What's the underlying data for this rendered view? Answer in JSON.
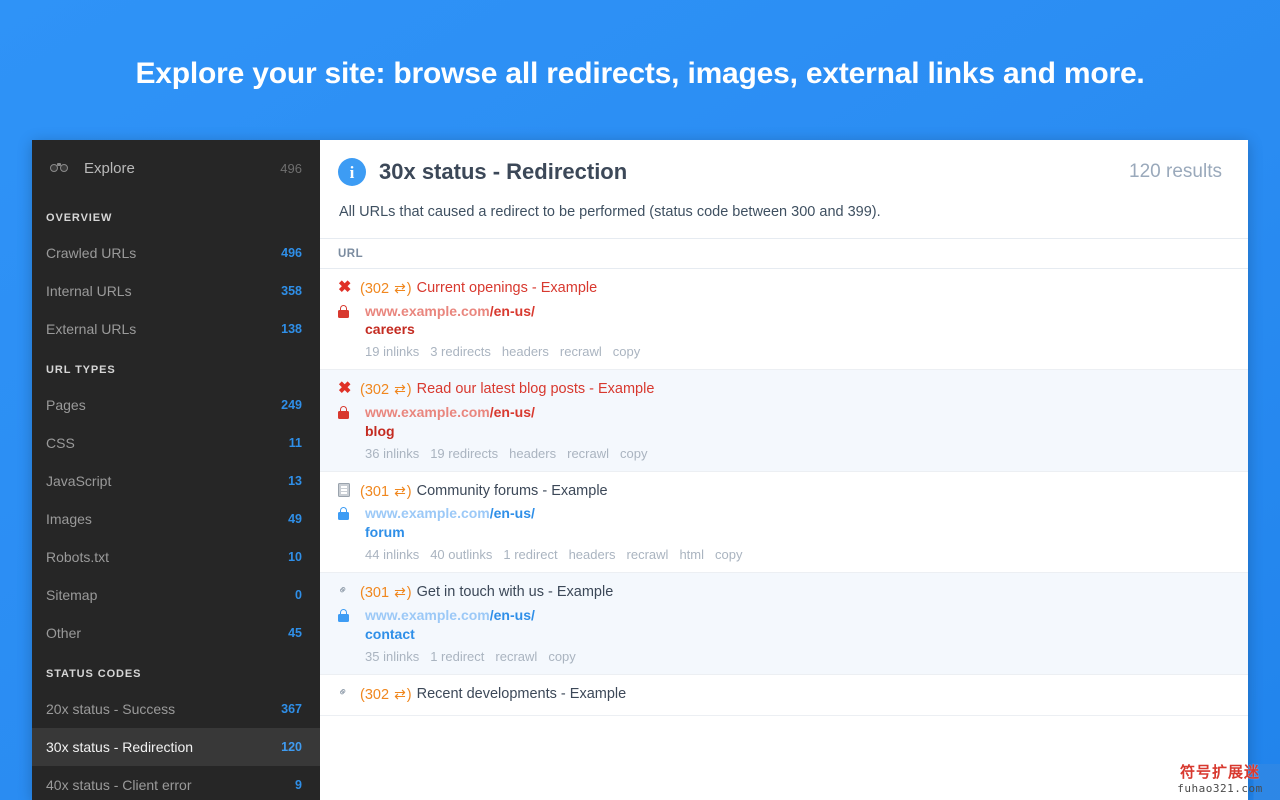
{
  "banner": {
    "title": "Explore your site: browse all redirects, images, external links and more."
  },
  "sidebar": {
    "explore": {
      "label": "Explore",
      "count": "496",
      "icon": "binoculars-icon"
    },
    "sections": [
      {
        "heading": "OVERVIEW",
        "items": [
          {
            "label": "Crawled URLs",
            "count": "496",
            "active": false
          },
          {
            "label": "Internal URLs",
            "count": "358",
            "active": false
          },
          {
            "label": "External URLs",
            "count": "138",
            "active": false
          }
        ]
      },
      {
        "heading": "URL TYPES",
        "items": [
          {
            "label": "Pages",
            "count": "249",
            "active": false
          },
          {
            "label": "CSS",
            "count": "11",
            "active": false
          },
          {
            "label": "JavaScript",
            "count": "13",
            "active": false
          },
          {
            "label": "Images",
            "count": "49",
            "active": false
          },
          {
            "label": "Robots.txt",
            "count": "10",
            "active": false
          },
          {
            "label": "Sitemap",
            "count": "0",
            "active": false
          },
          {
            "label": "Other",
            "count": "45",
            "active": false
          }
        ]
      },
      {
        "heading": "STATUS CODES",
        "items": [
          {
            "label": "20x status - Success",
            "count": "367",
            "active": false
          },
          {
            "label": "30x status - Redirection",
            "count": "120",
            "active": true
          },
          {
            "label": "40x status - Client error",
            "count": "9",
            "active": false
          }
        ]
      }
    ]
  },
  "main": {
    "info_icon": "info-circle-icon",
    "title": "30x status - Redirection",
    "results": "120 results",
    "description": "All URLs that caused a redirect to be performed (status code between 300 and 399).",
    "column_header": "URL",
    "rows": [
      {
        "type_icon": "error-x-icon",
        "status": "(302",
        "arrows": "⇄",
        "status_close": ")",
        "title": "Current openings - Example",
        "title_color": "red",
        "lock": "lock-red-icon",
        "domain": "www.example.com",
        "path": "/en-us/",
        "tail": "careers",
        "url_color": "red",
        "actions": [
          "19 inlinks",
          "3 redirects",
          "headers",
          "recrawl",
          "copy"
        ],
        "alt": false
      },
      {
        "type_icon": "error-x-icon",
        "status": "(302",
        "arrows": "⇄",
        "status_close": ")",
        "title": "Read our latest blog posts - Example",
        "title_color": "red",
        "lock": "lock-red-icon",
        "domain": "www.example.com",
        "path": "/en-us/",
        "tail": "blog",
        "url_color": "red",
        "actions": [
          "36 inlinks",
          "19 redirects",
          "headers",
          "recrawl",
          "copy"
        ],
        "alt": true
      },
      {
        "type_icon": "document-icon",
        "status": "(301",
        "arrows": "⇄",
        "status_close": ")",
        "title": "Community forums - Example",
        "title_color": "dark",
        "lock": "lock-blue-icon",
        "domain": "www.example.com",
        "path": "/en-us/",
        "tail": "forum",
        "url_color": "blue",
        "actions": [
          "44 inlinks",
          "40 outlinks",
          "1 redirect",
          "headers",
          "recrawl",
          "html",
          "copy"
        ],
        "alt": false
      },
      {
        "type_icon": "chain-link-icon",
        "status": "(301",
        "arrows": "⇄",
        "status_close": ")",
        "title": "Get in touch with us - Example",
        "title_color": "dark",
        "lock": "lock-blue-icon",
        "domain": "www.example.com",
        "path": "/en-us/",
        "tail": "contact",
        "url_color": "blue",
        "actions": [
          "35 inlinks",
          "1 redirect",
          "recrawl",
          "copy"
        ],
        "alt": true
      },
      {
        "type_icon": "chain-link-icon",
        "status": "(302",
        "arrows": "⇄",
        "status_close": ")",
        "title": "Recent developments - Example",
        "title_color": "dark",
        "lock": null,
        "domain": "",
        "path": "",
        "tail": "",
        "url_color": "blue",
        "actions": [],
        "alt": false
      }
    ]
  },
  "watermark": {
    "cn": "符号扩展迷",
    "en": "fuhao321.com"
  },
  "colors": {
    "banner_bg": "#2e91f5",
    "sidebar_bg": "#262626",
    "sidebar_active_bg": "#383838",
    "accent_blue": "#2f8fe8",
    "status_orange": "#f0871e",
    "error_red": "#d8392f",
    "row_alt_bg": "#f4f8fd"
  }
}
